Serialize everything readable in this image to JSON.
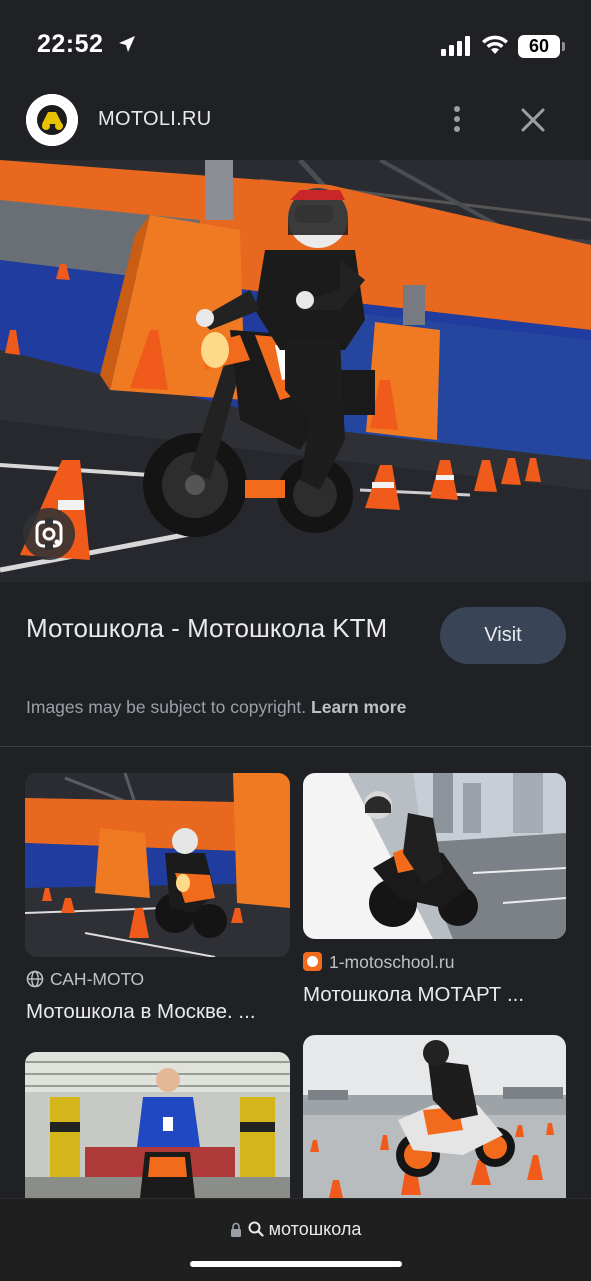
{
  "status": {
    "time": "22:52",
    "battery": "60"
  },
  "header": {
    "site_name": "MOTOLI.RU",
    "logo_icon": "motoli-logo-icon",
    "more_icon": "more-vert-icon",
    "close_icon": "close-icon"
  },
  "preview": {
    "image_icon": "ktm-motorcycle-training-photo",
    "lens_icon": "google-lens-icon"
  },
  "result": {
    "title": "Мотошкола - Мотошкола KTM",
    "visit_label": "Visit",
    "copyright_text": "Images may be subject to copyright.",
    "learn_more": "Learn more"
  },
  "related": [
    {
      "source": "САН-МОТО",
      "title": "Мотошкола в Москве. ...",
      "source_icon": "globe-icon"
    },
    {
      "source": "1-motoschool.ru",
      "title": "Мотошкола МОТАРТ ...",
      "source_icon": "motoschool-favicon-icon"
    },
    {
      "source": "",
      "title": "",
      "source_icon": ""
    },
    {
      "source": "",
      "title": "",
      "source_icon": ""
    }
  ],
  "bottom": {
    "query": "мотошкола",
    "lock_icon": "lock-icon",
    "search_icon": "search-icon"
  },
  "colors": {
    "background": "#202124",
    "visit_button": "#394457",
    "ktm_orange": "#f26b1d"
  }
}
